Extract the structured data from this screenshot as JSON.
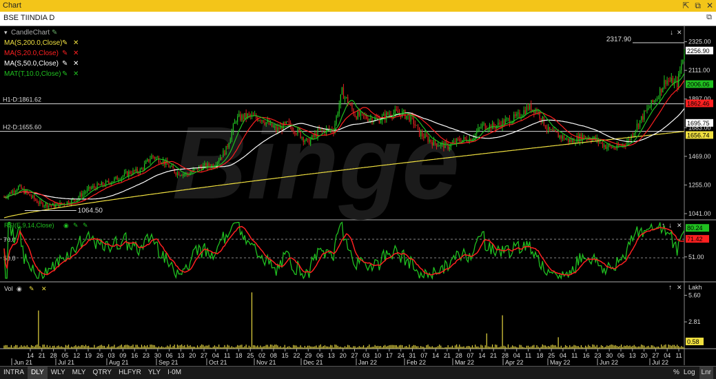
{
  "window": {
    "title": "Chart",
    "controls": [
      "⇱",
      "⧉",
      "✕"
    ]
  },
  "symbol": {
    "label": "BSE TIINDIA D"
  },
  "indicators": [
    {
      "label": "CandleChart",
      "color": "#aaaaaa"
    },
    {
      "label": "MA(S,200.0,Close)",
      "color": "#f0e040"
    },
    {
      "label": "MA(S,20.0,Close)",
      "color": "#ff2020"
    },
    {
      "label": "MA(S,50.0,Close)",
      "color": "#ffffff"
    },
    {
      "label": "MAT(T,10.0,Close)",
      "color": "#20c020"
    }
  ],
  "hlines": [
    {
      "label": "H1-D:1861.62",
      "value": 1861.62
    },
    {
      "label": "H2-D:1655.60",
      "value": 1655.6
    }
  ],
  "annotations": {
    "high": "2317.90",
    "low": "1064.50"
  },
  "price_axis": {
    "ticks": [
      "2325.00",
      "2111.00",
      "1897.00",
      "1683.00",
      "1469.00",
      "1255.00",
      "1041.00"
    ],
    "tags": [
      {
        "text": "2256.90",
        "bg": "#ffffff",
        "fg": "#000000"
      },
      {
        "text": "2006.06",
        "bg": "#20c020",
        "fg": "#000000"
      },
      {
        "text": "1862.46",
        "bg": "#ff2020",
        "fg": "#000000"
      },
      {
        "text": "1695.75",
        "bg": "#ffffff",
        "fg": "#000000"
      },
      {
        "text": "1656.74",
        "bg": "#f0e040",
        "fg": "#000000"
      }
    ]
  },
  "rsi": {
    "label": "RSI(E,9,14,Close)",
    "levels": [
      "70.0",
      "50.0"
    ],
    "axis_label": "51.00",
    "tags": [
      {
        "text": "80.24",
        "bg": "#20c020"
      },
      {
        "text": "71.42",
        "bg": "#ff2020"
      }
    ]
  },
  "volume": {
    "label": "Vol",
    "unit": "Lakh",
    "ticks": [
      "5.60",
      "2.81"
    ],
    "tag": "0.58"
  },
  "watermark": "Binge",
  "xaxis": {
    "days": [
      "14",
      "21",
      "28",
      "05",
      "12",
      "19",
      "26",
      "03",
      "09",
      "16",
      "23",
      "30",
      "06",
      "13",
      "20",
      "27",
      "04",
      "11",
      "18",
      "25",
      "02",
      "08",
      "15",
      "22",
      "29",
      "06",
      "13",
      "20",
      "27",
      "03",
      "10",
      "17",
      "24",
      "31",
      "07",
      "14",
      "21",
      "28",
      "07",
      "14",
      "21",
      "28",
      "04",
      "11",
      "18",
      "25",
      "04",
      "11",
      "16",
      "23",
      "30",
      "06",
      "13",
      "20",
      "27",
      "04",
      "11"
    ],
    "months": [
      "Jun 21",
      "Jul 21",
      "Aug 21",
      "Sep 21",
      "Oct 21",
      "Nov 21",
      "Dec 21",
      "Jan 22",
      "Feb 22",
      "Mar 22",
      "Apr 22",
      "May 22",
      "Jun 22",
      "Jul 22"
    ]
  },
  "timeframes": [
    "INTRA",
    "DLY",
    "WLY",
    "MLY",
    "QTRY",
    "HLFYR",
    "YLY",
    "I-0M"
  ],
  "active_timeframe": "DLY",
  "scale_controls": [
    "%",
    "Log",
    "Lnr"
  ],
  "active_scale": "Lnr",
  "chart_data": {
    "type": "candlestick",
    "price_keypoints": [
      [
        0,
        1165
      ],
      [
        10,
        1240
      ],
      [
        18,
        1175
      ],
      [
        25,
        1115
      ],
      [
        35,
        1100
      ],
      [
        48,
        1140
      ],
      [
        60,
        1230
      ],
      [
        70,
        1260
      ],
      [
        80,
        1310
      ],
      [
        88,
        1350
      ],
      [
        95,
        1360
      ],
      [
        103,
        1470
      ],
      [
        110,
        1440
      ],
      [
        120,
        1350
      ],
      [
        128,
        1335
      ],
      [
        137,
        1390
      ],
      [
        146,
        1400
      ],
      [
        155,
        1520
      ],
      [
        162,
        1750
      ],
      [
        170,
        1770
      ],
      [
        180,
        1750
      ],
      [
        190,
        1665
      ],
      [
        198,
        1710
      ],
      [
        205,
        1650
      ],
      [
        212,
        1570
      ],
      [
        220,
        1660
      ],
      [
        230,
        1670
      ],
      [
        236,
        1950
      ],
      [
        245,
        1780
      ],
      [
        255,
        1755
      ],
      [
        262,
        1745
      ],
      [
        270,
        1795
      ],
      [
        278,
        1790
      ],
      [
        285,
        1745
      ],
      [
        290,
        1640
      ],
      [
        300,
        1570
      ],
      [
        310,
        1545
      ],
      [
        318,
        1590
      ],
      [
        326,
        1600
      ],
      [
        334,
        1700
      ],
      [
        342,
        1690
      ],
      [
        350,
        1730
      ],
      [
        358,
        1760
      ],
      [
        366,
        1835
      ],
      [
        372,
        1815
      ],
      [
        380,
        1660
      ],
      [
        388,
        1620
      ],
      [
        396,
        1580
      ],
      [
        404,
        1620
      ],
      [
        412,
        1600
      ],
      [
        420,
        1545
      ],
      [
        428,
        1530
      ],
      [
        436,
        1585
      ],
      [
        442,
        1700
      ],
      [
        448,
        1800
      ],
      [
        456,
        1915
      ],
      [
        462,
        2040
      ],
      [
        470,
        2010
      ],
      [
        475,
        2260
      ]
    ],
    "volume_spikes": [
      [
        24,
        4.0
      ],
      [
        173,
        5.9
      ],
      [
        337,
        1.6
      ],
      [
        348,
        3.5
      ],
      [
        387,
        1.2
      ]
    ],
    "ma200_range": [
      1010,
      1655
    ],
    "price_ylim": [
      1000,
      2400
    ],
    "rsi_ylim": [
      25,
      90
    ],
    "volume_ylim": [
      0,
      6.5
    ]
  }
}
